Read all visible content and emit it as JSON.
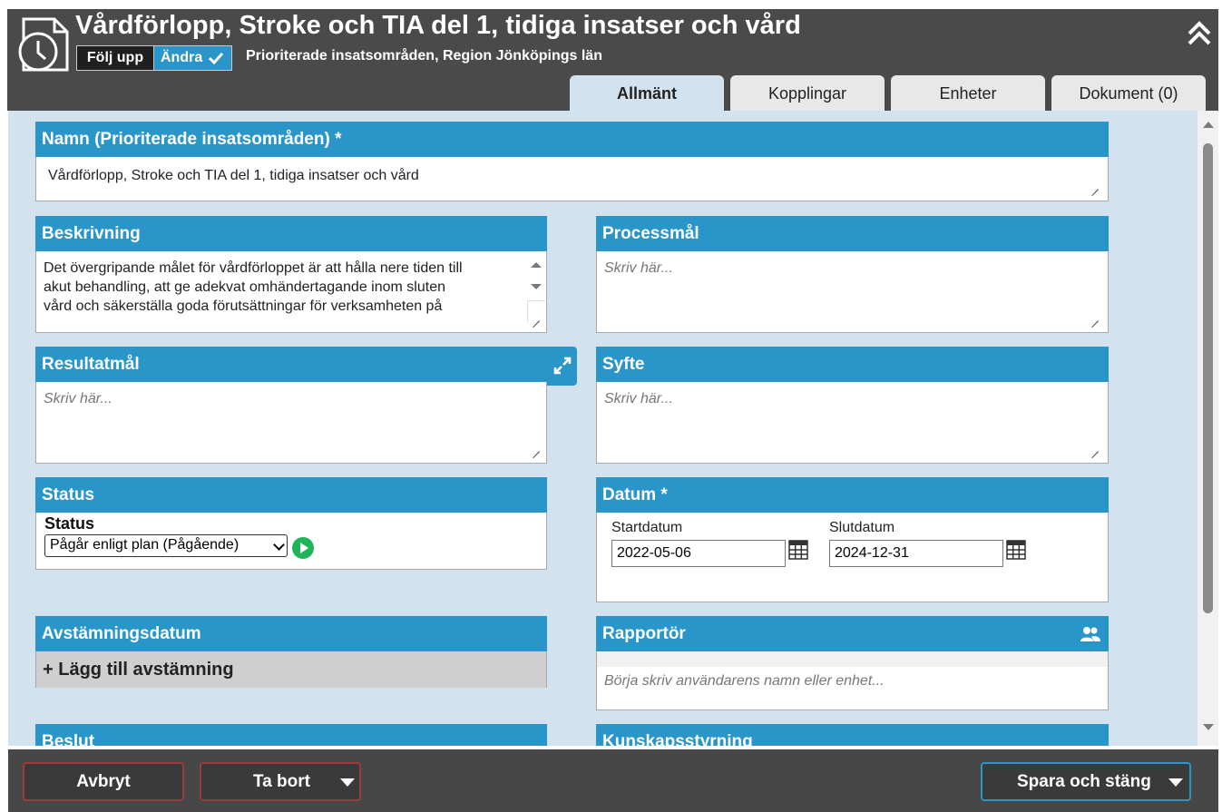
{
  "header": {
    "title": "Vårdförlopp, Stroke och TIA del 1, tidiga insatser och vård",
    "follow_label": "Följ upp",
    "edit_label": "Ändra",
    "subtitle": "Prioriterade insatsområden, Region Jönköpings län",
    "icons": {
      "doc": "document-clock-icon",
      "collapse": "double-chevron-up-icon",
      "edit_check": "check-icon"
    }
  },
  "tabs": [
    {
      "label": "Allmänt",
      "active": true
    },
    {
      "label": "Kopplingar",
      "active": false
    },
    {
      "label": "Enheter",
      "active": false
    },
    {
      "label": "Dokument (0)",
      "active": false
    }
  ],
  "fields": {
    "name": {
      "label": "Namn (Prioriterade insatsområden) *",
      "value": "Vårdförlopp, Stroke och TIA del 1, tidiga insatser och vård"
    },
    "description": {
      "label": "Beskrivning",
      "lines": [
        "Det övergripande målet för vårdförloppet är att hålla nere tiden till",
        "akut behandling, att ge adekvat omhändertagande inom sluten",
        "vård och säkerställa goda förutsättningar för verksamheten på"
      ]
    },
    "process_goal": {
      "label": "Processmål",
      "placeholder": "Skriv här..."
    },
    "result_goal": {
      "label": "Resultatmål",
      "placeholder": "Skriv här..."
    },
    "purpose": {
      "label": "Syfte",
      "placeholder": "Skriv här..."
    },
    "status": {
      "label": "Status",
      "sublabel": "Status",
      "selected": "Pågår enligt plan (Pågående)"
    },
    "date": {
      "label": "Datum *",
      "start_label": "Startdatum",
      "start_value": "2022-05-06",
      "end_label": "Slutdatum",
      "end_value": "2024-12-31"
    },
    "reconciliation": {
      "label": "Avstämningsdatum",
      "add_label": "+ Lägg till avstämning"
    },
    "reporter": {
      "label": "Rapportör",
      "placeholder": "Börja skriv användarens namn eller enhet..."
    },
    "decision": {
      "label": "Beslut"
    },
    "knowledge": {
      "label": "Kunskapsstyrning"
    }
  },
  "footer": {
    "cancel": "Avbryt",
    "delete": "Ta bort",
    "save_close": "Spara och stäng"
  },
  "colors": {
    "accent": "#2a95c9",
    "background": "#d2e3ef",
    "header": "#4a4a4a",
    "play": "#20b35a"
  }
}
